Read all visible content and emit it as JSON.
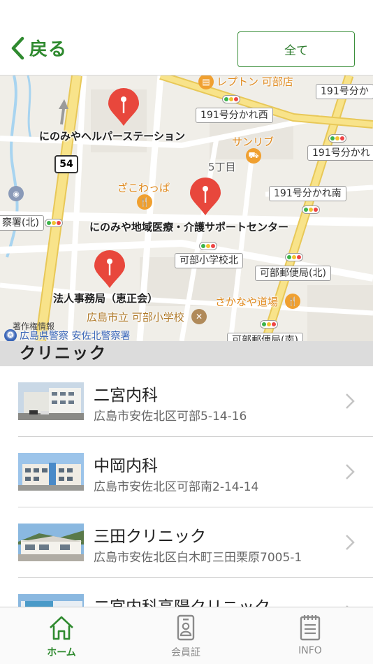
{
  "header": {
    "back_label": "戻る",
    "all_button": "全て"
  },
  "map": {
    "places": [
      "にのみやヘルパーステーション",
      "にのみや地域医療・介護サポートセンター",
      "法人事務局（恵正会）"
    ],
    "road_signs": [
      "191号分かれ西",
      "191号分かれ",
      "191号分かれ南",
      "可部小学校北",
      "可部郵便局(北)",
      "191号分か",
      "可部郵便局(南)",
      "察署(北)"
    ],
    "orange_labels": [
      "レプトン 可部店",
      "サンリブ",
      "ざこわっぱ",
      "さかなや道場",
      "広島市立 可部小学校"
    ],
    "area_label": "5丁目",
    "route_number": "54",
    "attribution": "著作権情報",
    "police": "広島県警察 安佐北警察署"
  },
  "section": {
    "title": "クリニック"
  },
  "clinics": [
    {
      "name": "二宮内科",
      "address": "広島市安佐北区可部5-14-16"
    },
    {
      "name": "中岡内科",
      "address": "広島市安佐北区可部南2-14-14"
    },
    {
      "name": "三田クリニック",
      "address": "広島市安佐北区白木町三田栗原7005-1"
    },
    {
      "name": "二宮内科高陽クリニック",
      "address": ""
    }
  ],
  "tabs": [
    {
      "label": "ホーム",
      "icon": "home-icon",
      "active": true
    },
    {
      "label": "会員証",
      "icon": "member-card-icon",
      "active": false
    },
    {
      "label": "INFO",
      "icon": "info-notepad-icon",
      "active": false
    }
  ],
  "colors": {
    "accent": "#2f8a2f",
    "pin": "#e8473c",
    "road_yellow": "#f6df7c"
  }
}
